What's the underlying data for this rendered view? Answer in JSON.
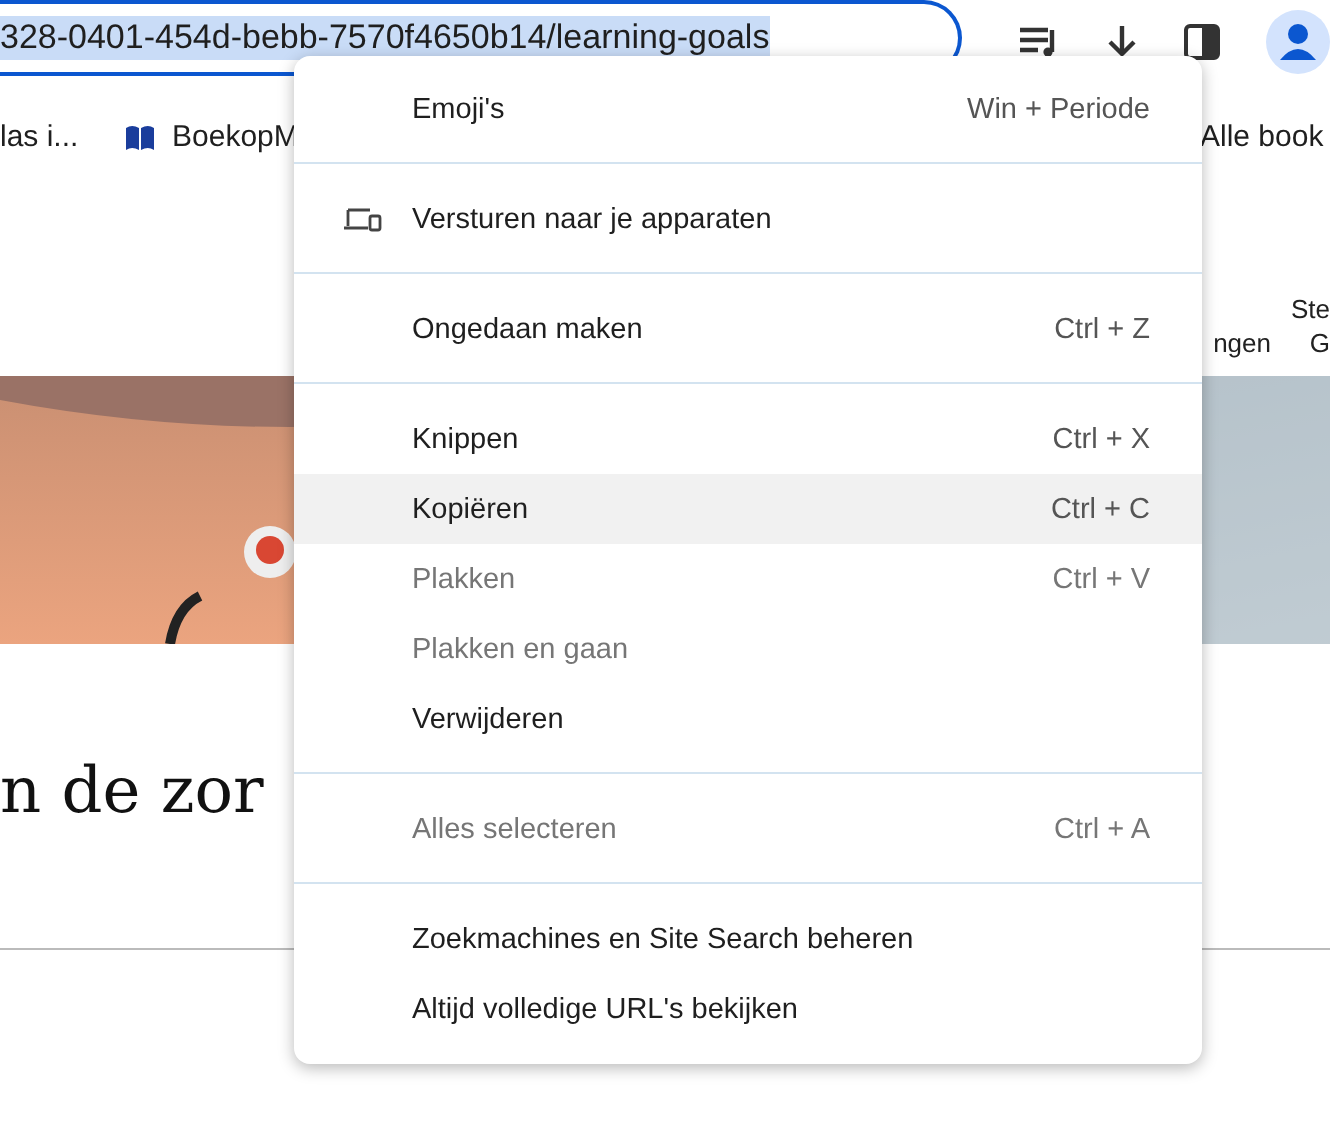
{
  "address_bar": {
    "value": "328-0401-454d-bebb-7570f4650b14/learning-goals",
    "selected": true
  },
  "bookmarks": [
    {
      "label": "las i...",
      "kind": "plain"
    },
    {
      "label": "BoekopM",
      "kind": "book"
    },
    {
      "label": "Alle book",
      "kind": "plain"
    }
  ],
  "page": {
    "nav": [
      {
        "label": "ngen"
      },
      {
        "label": "Ste\nG"
      }
    ],
    "heading": "n de zor"
  },
  "context_menu": {
    "sections": [
      [
        {
          "label": "Emoji's",
          "shortcut": "Win + Periode",
          "disabled": false,
          "selected": false,
          "kind": "plain"
        }
      ],
      [
        {
          "label": "Versturen naar je apparaten",
          "disabled": false,
          "selected": false,
          "kind": "devices"
        }
      ],
      [
        {
          "label": "Ongedaan maken",
          "shortcut": "Ctrl + Z",
          "disabled": false,
          "selected": false,
          "kind": "plain"
        }
      ],
      [
        {
          "label": "Knippen",
          "shortcut": "Ctrl + X",
          "disabled": false,
          "selected": false,
          "kind": "plain"
        },
        {
          "label": "Kopiëren",
          "shortcut": "Ctrl + C",
          "disabled": false,
          "selected": true,
          "kind": "plain"
        },
        {
          "label": "Plakken",
          "shortcut": "Ctrl + V",
          "disabled": true,
          "selected": false,
          "kind": "plain"
        },
        {
          "label": "Plakken en gaan",
          "disabled": true,
          "selected": false,
          "kind": "plain"
        },
        {
          "label": "Verwijderen",
          "disabled": false,
          "selected": false,
          "kind": "plain"
        }
      ],
      [
        {
          "label": "Alles selecteren",
          "shortcut": "Ctrl + A",
          "disabled": true,
          "selected": false,
          "kind": "plain"
        }
      ],
      [
        {
          "label": "Zoekmachines en Site Search beheren",
          "disabled": false,
          "selected": false,
          "kind": "plain"
        },
        {
          "label": "Altijd volledige URL's bekijken",
          "disabled": false,
          "selected": false,
          "kind": "plain"
        }
      ]
    ]
  }
}
